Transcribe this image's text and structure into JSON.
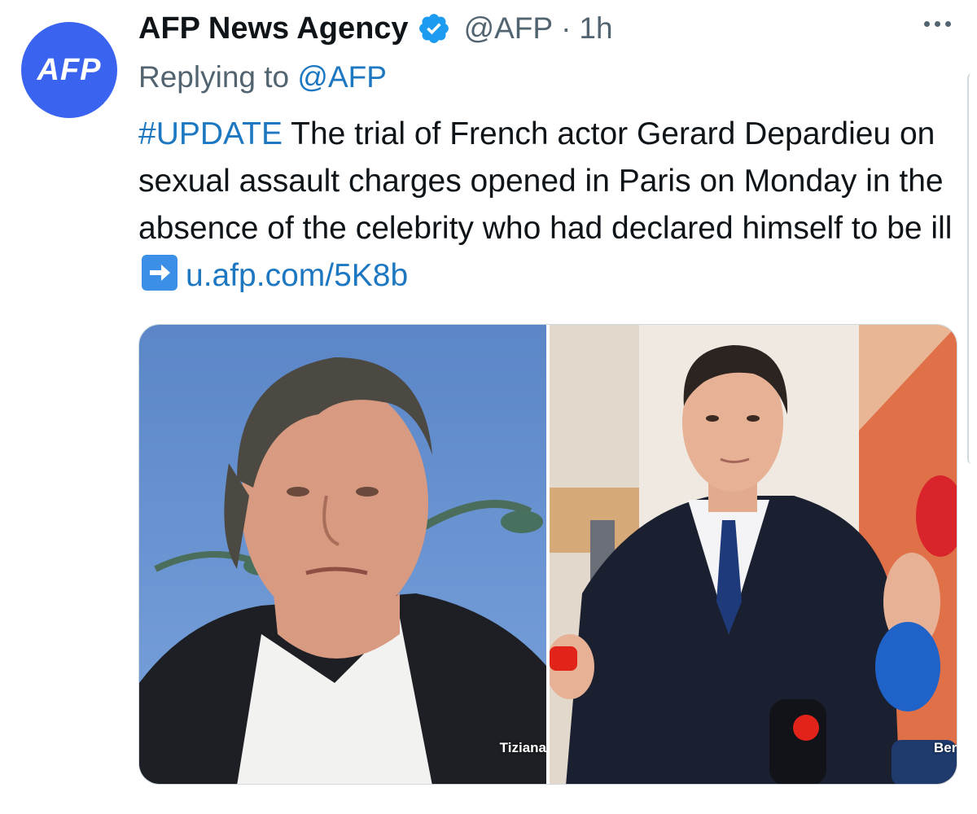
{
  "tweet": {
    "avatar_text": "AFP",
    "display_name": "AFP News Agency",
    "handle": "@AFP",
    "separator": "·",
    "time": "1h",
    "replying_prefix": "Replying to",
    "replying_handle": "@AFP",
    "hashtag": "#UPDATE",
    "text_main": " The trial of French actor Gerard Depardieu on sexual assault charges opened in Paris on Monday in the absence of the celebrity who had declared himself to be ill",
    "link": "u.afp.com/5K8b",
    "media": {
      "left_credit": "Tiziana",
      "right_credit": "Ber"
    }
  },
  "colors": {
    "accent": "#1d78c1",
    "avatar_bg": "#3a63f0",
    "verified": "#1d9bf0",
    "muted_text": "#536471"
  },
  "icons": {
    "verified": "verified-badge-icon",
    "more": "more-dots-icon",
    "arrow": "right-arrow-emoji-icon"
  }
}
